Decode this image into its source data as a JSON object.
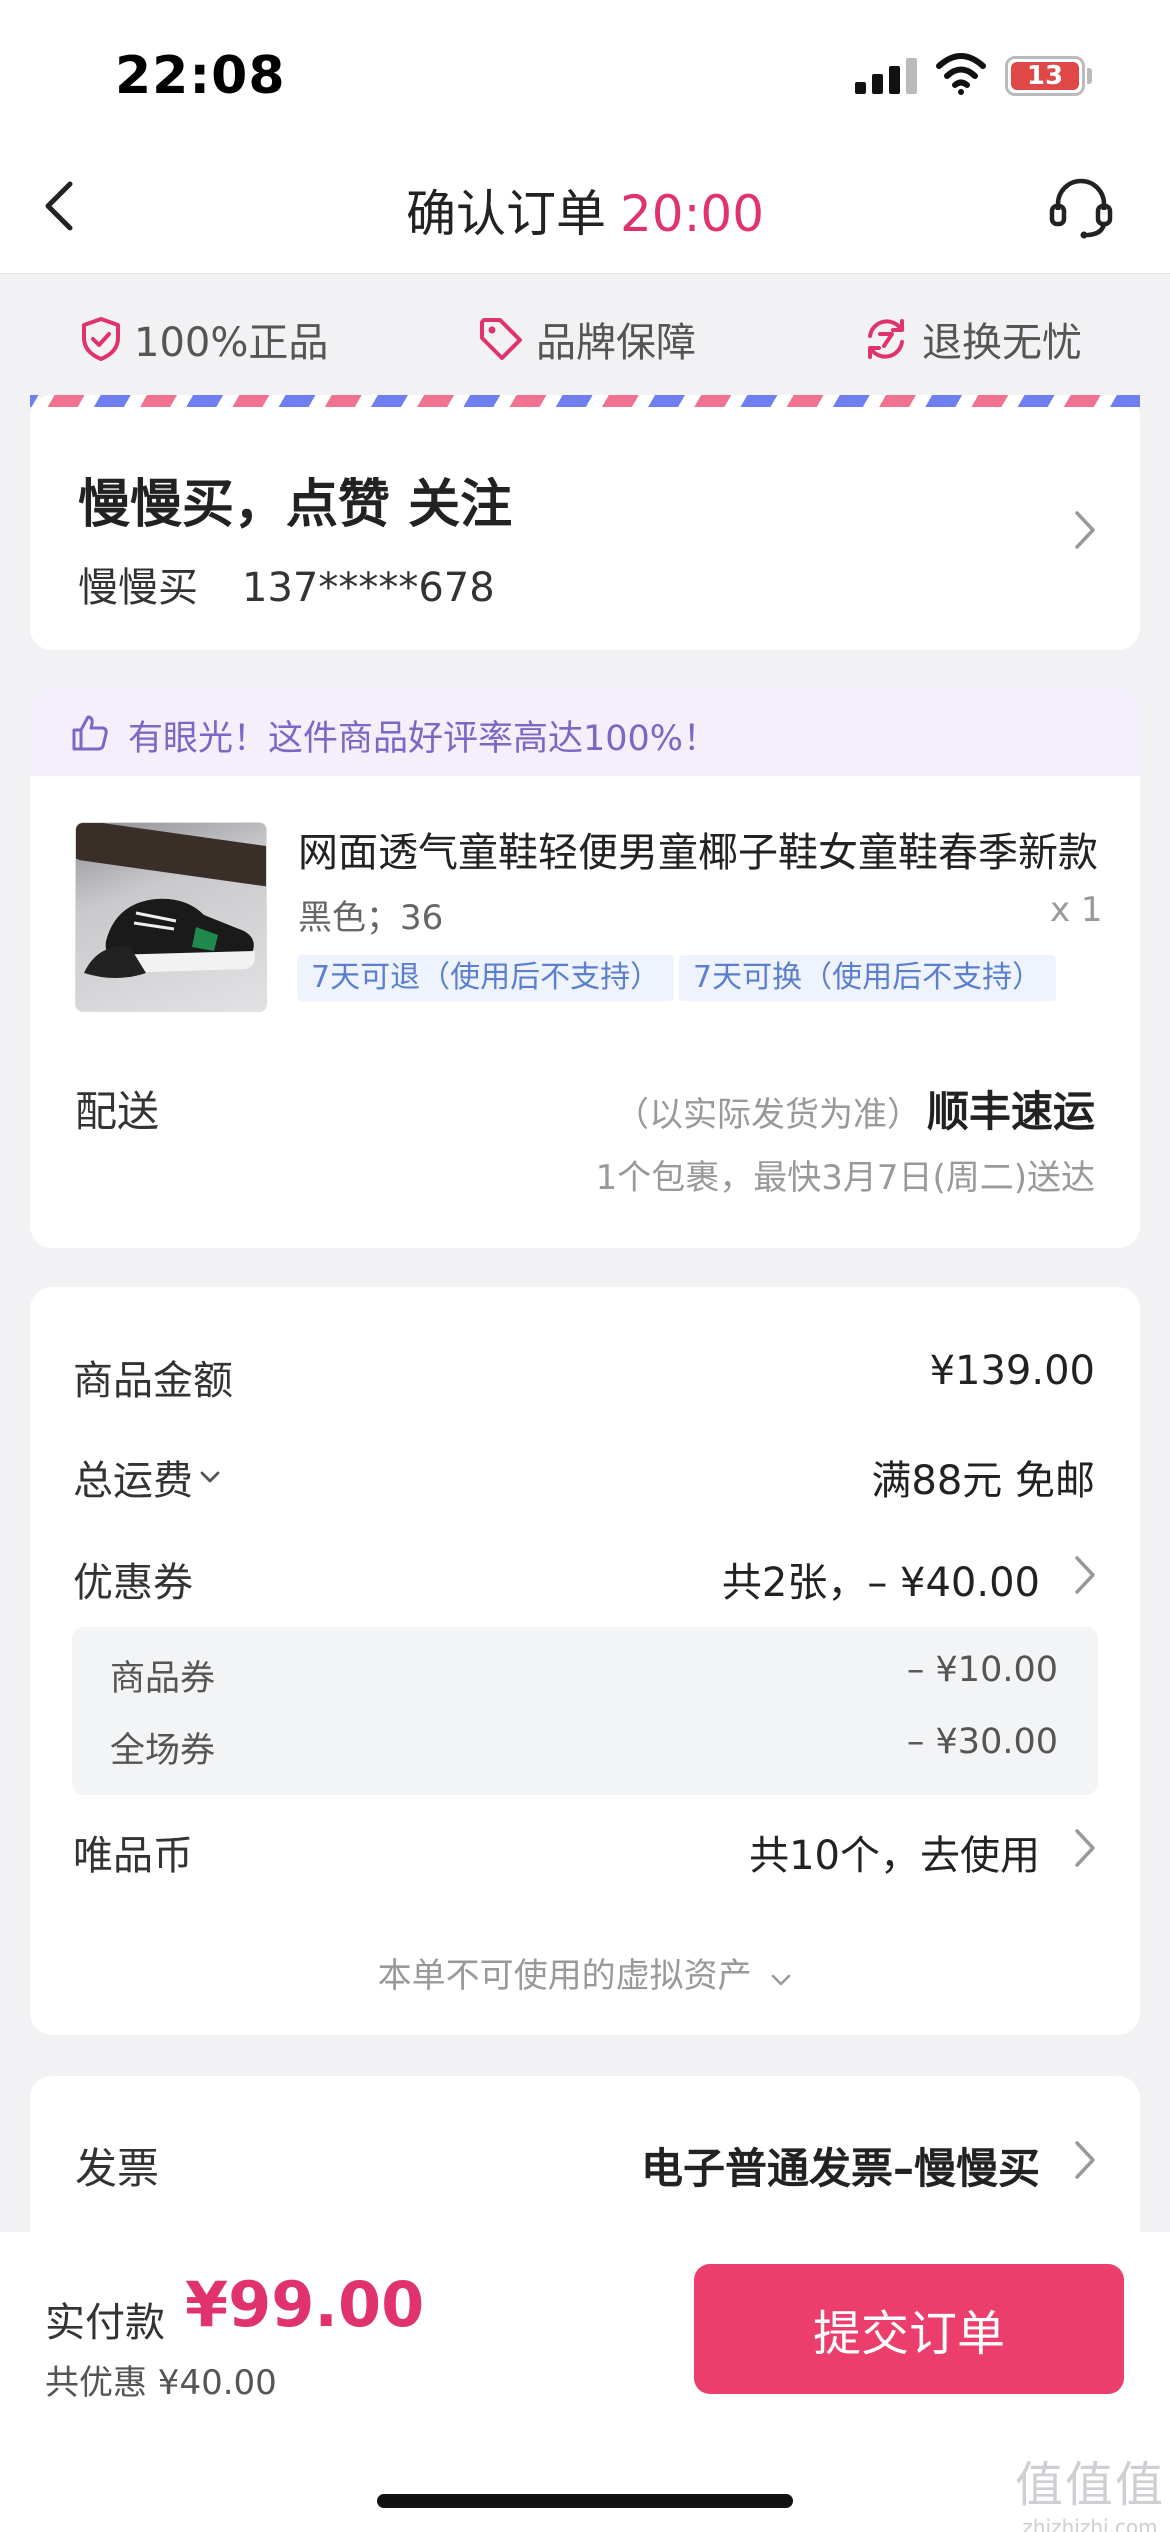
{
  "status_bar": {
    "time": "22:08",
    "battery": "13"
  },
  "nav": {
    "title": "确认订单",
    "countdown": "20:00"
  },
  "guarantees": [
    {
      "icon": "shield-check-icon",
      "label": "100%正品"
    },
    {
      "icon": "price-tag-icon",
      "label": "品牌保障"
    },
    {
      "icon": "return-exchange-icon",
      "label": "退换无忧"
    }
  ],
  "address": {
    "name_line": "慢慢买，点赞 关注",
    "recipient": "慢慢买",
    "phone": "137*****678"
  },
  "product": {
    "praise": "有眼光！这件商品好评率高达100%！",
    "title": "网面透气童鞋轻便男童椰子鞋女童鞋春季新款",
    "spec": "黑色；36",
    "quantity": "x 1",
    "tags": [
      "7天可退（使用后不支持）",
      "7天可换（使用后不支持）"
    ],
    "shipping_label": "配送",
    "shipping_note": "（以实际发货为准）",
    "shipping_carrier": "顺丰速运",
    "shipping_eta": "1个包裹，最快3月7日(周二)送达"
  },
  "pricing": {
    "goods_label": "商品金额",
    "goods_value": "¥139.00",
    "freight_label": "总运费",
    "freight_value": "满88元 免邮",
    "coupon_label": "优惠券",
    "coupon_value": "共2张，– ¥40.00",
    "coupons": [
      {
        "label": "商品券",
        "value": "– ¥10.00"
      },
      {
        "label": "全场券",
        "value": "– ¥30.00"
      }
    ],
    "coins_label": "唯品币",
    "coins_value": "共10个，去使用",
    "virtual_note": "本单不可使用的虚拟资产"
  },
  "invoice": {
    "label": "发票",
    "value": "电子普通发票–慢慢买"
  },
  "bottom": {
    "pay_label": "实付款",
    "pay_amount": "¥99.00",
    "saved": "共优惠 ¥40.00",
    "submit": "提交订单"
  },
  "watermark": {
    "logo": "值值值",
    "url": "zhizhizhi.com"
  },
  "colors": {
    "accent": "#e0336d",
    "button": "#ec3e6c",
    "praise": "#7a68c4",
    "tag_text": "#5b7fce"
  }
}
